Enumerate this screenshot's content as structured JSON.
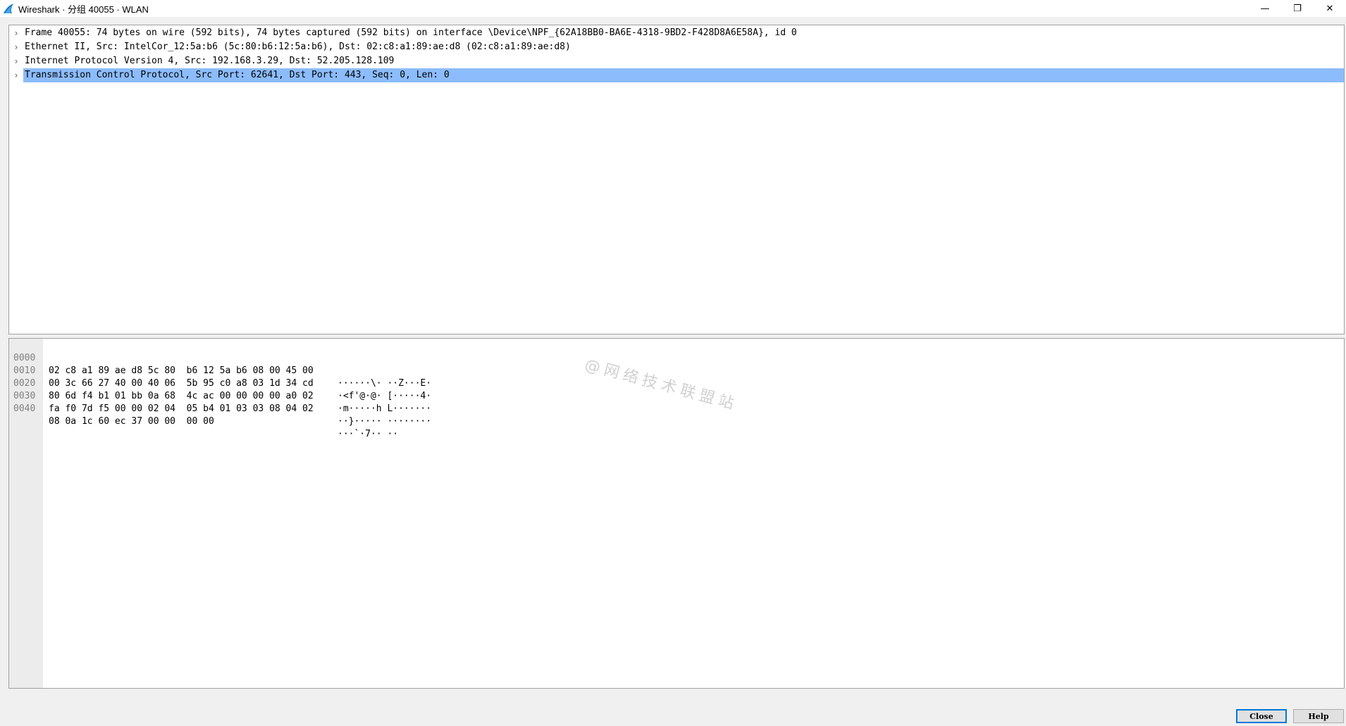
{
  "window": {
    "title": "Wireshark · 分组 40055 · WLAN",
    "controls": {
      "minimize": "—",
      "restore": "❐",
      "close": "✕"
    }
  },
  "tree": {
    "items": [
      {
        "label": "Frame 40055: 74 bytes on wire (592 bits), 74 bytes captured (592 bits) on interface \\Device\\NPF_{62A18BB0-BA6E-4318-9BD2-F428D8A6E58A}, id 0",
        "expanded": false,
        "selected": false
      },
      {
        "label": "Ethernet II, Src: IntelCor_12:5a:b6 (5c:80:b6:12:5a:b6), Dst: 02:c8:a1:89:ae:d8 (02:c8:a1:89:ae:d8)",
        "expanded": false,
        "selected": false
      },
      {
        "label": "Internet Protocol Version 4, Src: 192.168.3.29, Dst: 52.205.128.109",
        "expanded": false,
        "selected": false
      },
      {
        "label": "Transmission Control Protocol, Src Port: 62641, Dst Port: 443, Seq: 0, Len: 0",
        "expanded": false,
        "selected": true
      }
    ],
    "collapsed_glyph": "›"
  },
  "bytes": {
    "lines": [
      {
        "offset": "0000",
        "hex": "02 c8 a1 89 ae d8 5c 80  b6 12 5a b6 08 00 45 00",
        "ascii": "······\\· ··Z···E·"
      },
      {
        "offset": "0010",
        "hex": "00 3c 66 27 40 00 40 06  5b 95 c0 a8 03 1d 34 cd",
        "ascii": "·<f'@·@· [·····4·"
      },
      {
        "offset": "0020",
        "hex": "80 6d f4 b1 01 bb 0a 68  4c ac 00 00 00 00 a0 02",
        "ascii": "·m·····h L·······"
      },
      {
        "offset": "0030",
        "hex": "fa f0 7d f5 00 00 02 04  05 b4 01 03 03 08 04 02",
        "ascii": "··}····· ········"
      },
      {
        "offset": "0040",
        "hex": "08 0a 1c 60 ec 37 00 00  00 00",
        "ascii": "···`·7·· ··"
      }
    ]
  },
  "watermark": "@网络技术联盟站",
  "buttons": {
    "close": "Close",
    "help": "Help"
  },
  "colors": {
    "selection": "#8cbcfb",
    "focus_border": "#0078d7"
  }
}
